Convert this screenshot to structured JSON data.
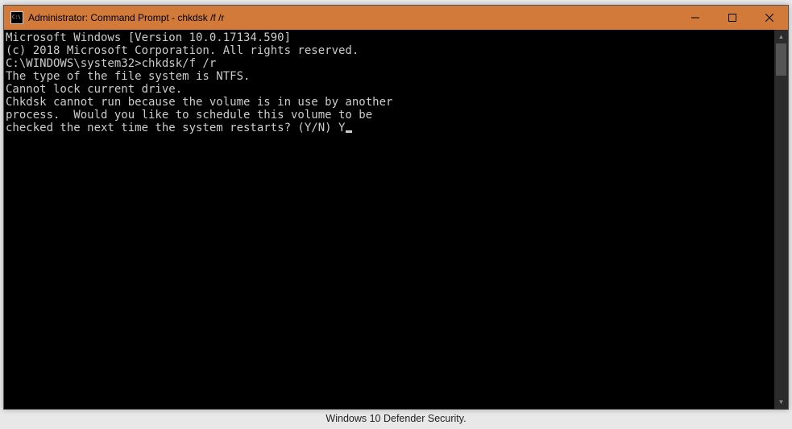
{
  "titlebar": {
    "icon_label": "cmd-icon",
    "title": "Administrator: Command Prompt - chkdsk /f /r",
    "minimize": "—",
    "maximize": "▢",
    "close": "✕"
  },
  "console": {
    "lines": [
      "Microsoft Windows [Version 10.0.17134.590]",
      "(c) 2018 Microsoft Corporation. All rights reserved.",
      "",
      "C:\\WINDOWS\\system32>chkdsk/f /r",
      "The type of the file system is NTFS.",
      "Cannot lock current drive.",
      "",
      "Chkdsk cannot run because the volume is in use by another",
      "process.  Would you like to schedule this volume to be",
      "checked the next time the system restarts? (Y/N) Y"
    ],
    "prompt_path": "C:\\WINDOWS\\system32>",
    "command": "chkdsk/f /r",
    "response": "Y"
  },
  "background": {
    "caption": "Windows 10 Defender Security."
  },
  "scrollbar": {
    "up": "▲",
    "down": "▼"
  }
}
